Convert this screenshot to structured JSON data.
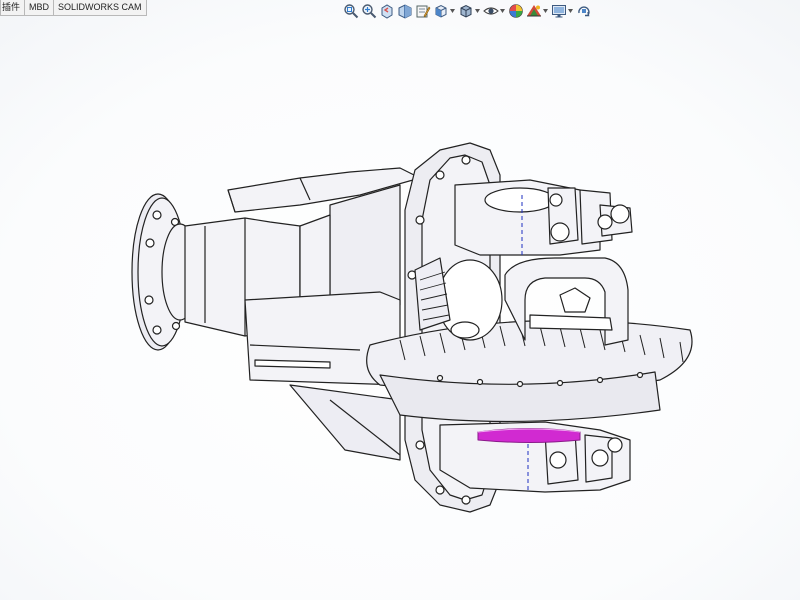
{
  "app": {
    "name": "SOLIDWORKS"
  },
  "tabs": [
    {
      "label": "插件"
    },
    {
      "label": "MBD"
    },
    {
      "label": "SOLIDWORKS CAM"
    }
  ],
  "heads_up_toolbar": {
    "icons": [
      "zoom-to-fit-icon",
      "zoom-to-area-icon",
      "previous-view-icon",
      "section-view-icon",
      "dynamic-annotation-view-icon",
      "view-orientation-icon",
      "display-style-icon",
      "hide-show-items-icon",
      "edit-appearance-icon",
      "apply-scene-icon",
      "view-settings-icon",
      "rotate-view-icon"
    ]
  },
  "model": {
    "description_icon": "differential-assembly",
    "highlight_color": "#d12ad1",
    "edge_color": "#222222",
    "body_color": "#f4f4f8"
  }
}
